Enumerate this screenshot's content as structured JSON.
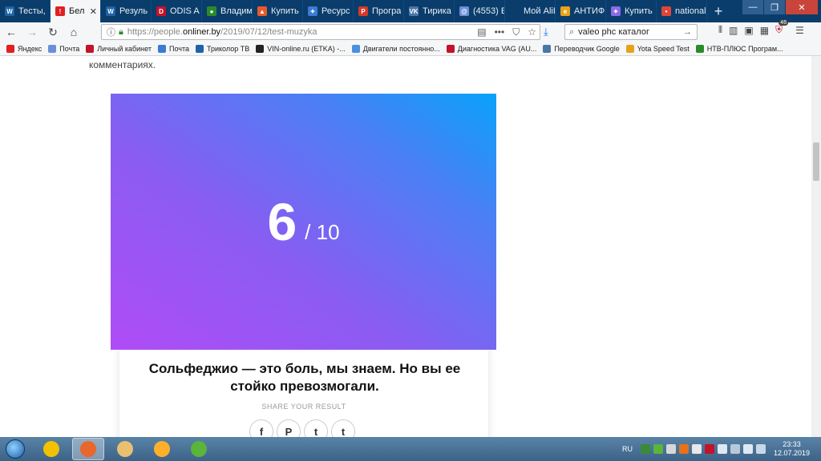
{
  "tabs": [
    {
      "label": "Тесты, ",
      "color": "#1f63a8",
      "glyph": "W"
    },
    {
      "label": "Бел",
      "color": "#e02020",
      "glyph": "!",
      "active": true
    },
    {
      "label": "Резуль",
      "color": "#1f63a8",
      "glyph": "W"
    },
    {
      "label": "ODIS A",
      "color": "#c2132a",
      "glyph": "D"
    },
    {
      "label": "Владим",
      "color": "#2a8a2a",
      "glyph": "●"
    },
    {
      "label": "Купить",
      "color": "#e85a2a",
      "glyph": "▲"
    },
    {
      "label": "Ресурс",
      "color": "#3a7bd5",
      "glyph": "✦"
    },
    {
      "label": "Програ",
      "color": "#d23a2a",
      "glyph": "P"
    },
    {
      "label": "Тирика",
      "color": "#4a76a8",
      "glyph": "VK"
    },
    {
      "label": "(4553) E",
      "color": "#6a8fd8",
      "glyph": "@"
    },
    {
      "label": "Мой AliExpr",
      "color": "transparent",
      "glyph": ""
    },
    {
      "label": "АНТИФ",
      "color": "#e6a21b",
      "glyph": "e"
    },
    {
      "label": "Купить",
      "color": "#8a6ae8",
      "glyph": "✦"
    },
    {
      "label": "national",
      "color": "#e0453a",
      "glyph": "•"
    }
  ],
  "url": {
    "prefix": "https://people.",
    "domain": "onliner.by",
    "path": "/2019/07/12/test-muzyka"
  },
  "search": {
    "value": "valeo phc каталог"
  },
  "addon_badge": "46",
  "bookmarks": [
    {
      "label": "Яндекс",
      "color": "#e02020"
    },
    {
      "label": "Почта",
      "color": "#6a8fd8"
    },
    {
      "label": "Личный кабинет",
      "color": "#c2132a"
    },
    {
      "label": "Почта",
      "color": "#3a7bd5"
    },
    {
      "label": "Триколор ТВ",
      "color": "#1f63a8"
    },
    {
      "label": "VIN-online.ru (ETKA) -...",
      "color": "#222222"
    },
    {
      "label": "Двигатели постоянно...",
      "color": "#4a90e2"
    },
    {
      "label": "Диагностика VAG (AU...",
      "color": "#c2132a"
    },
    {
      "label": "Переводчик Google",
      "color": "#4a76a8"
    },
    {
      "label": "Yota Speed Test",
      "color": "#e6a21b"
    },
    {
      "label": "НТВ-ПЛЮС Програм...",
      "color": "#2a8a2a"
    }
  ],
  "page": {
    "intro": "комментариях.",
    "score": "6",
    "total": "/ 10",
    "result_title": "Сольфеджио — это боль, мы знаем. Но вы ее стойко превозмогали.",
    "share_label": "SHARE YOUR RESULT",
    "share_icons": [
      "facebook-icon",
      "pinterest-icon",
      "twitter-icon",
      "tumblr-icon"
    ],
    "share_glyphs": [
      "f",
      "P",
      "t",
      "t"
    ]
  },
  "taskbar": {
    "lang": "RU",
    "time": "23:33",
    "date": "12.07.2019",
    "apps": [
      {
        "name": "chrome-icon",
        "color": "#f2c200"
      },
      {
        "name": "firefox-icon",
        "color": "#e8672a",
        "active": true
      },
      {
        "name": "explorer-icon",
        "color": "#e8c070"
      },
      {
        "name": "media-player-icon",
        "color": "#ffb02a"
      },
      {
        "name": "icq-icon",
        "color": "#5ab53a"
      }
    ]
  }
}
